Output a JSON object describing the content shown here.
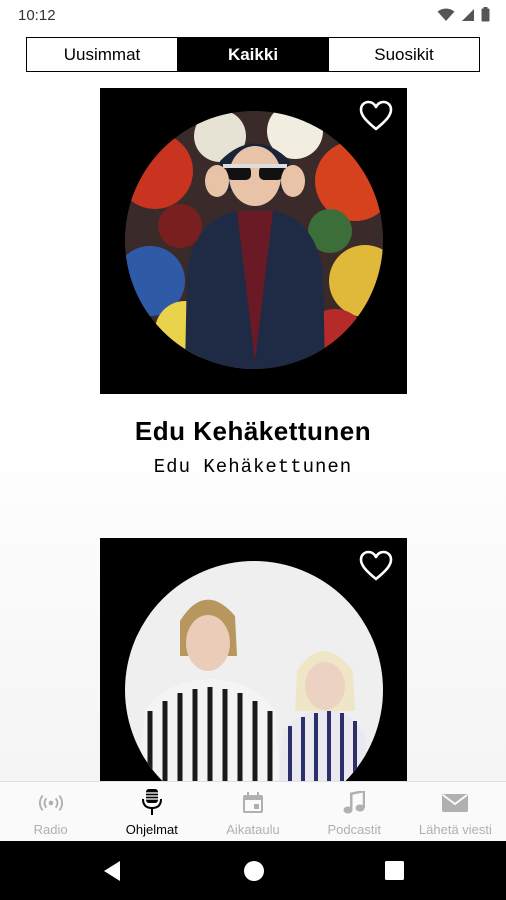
{
  "status_bar": {
    "time": "10:12",
    "icons": [
      "wifi-icon",
      "signal-icon",
      "battery-icon"
    ]
  },
  "tabs": [
    {
      "label": "Uusimmat",
      "active": false
    },
    {
      "label": "Kaikki",
      "active": true
    },
    {
      "label": "Suosikit",
      "active": false
    }
  ],
  "shows": [
    {
      "title": "Edu Kehäkettunen",
      "host": "Edu Kehäkettunen",
      "favorite_icon": "heart-outline-icon"
    },
    {
      "title": "",
      "host": "",
      "favorite_icon": "heart-outline-icon"
    }
  ],
  "bottom_nav": [
    {
      "label": "Radio",
      "icon": "radio-waves-icon",
      "active": false
    },
    {
      "label": "Ohjelmat",
      "icon": "microphone-icon",
      "active": true
    },
    {
      "label": "Aikataulu",
      "icon": "calendar-icon",
      "active": false
    },
    {
      "label": "Podcastit",
      "icon": "music-note-icon",
      "active": false
    },
    {
      "label": "Lähetä viesti",
      "icon": "envelope-icon",
      "active": false
    }
  ],
  "system_nav": [
    "back-icon",
    "home-icon",
    "recents-icon"
  ],
  "colors": {
    "accent": "#000000",
    "inactive": "#b0b0b0"
  }
}
